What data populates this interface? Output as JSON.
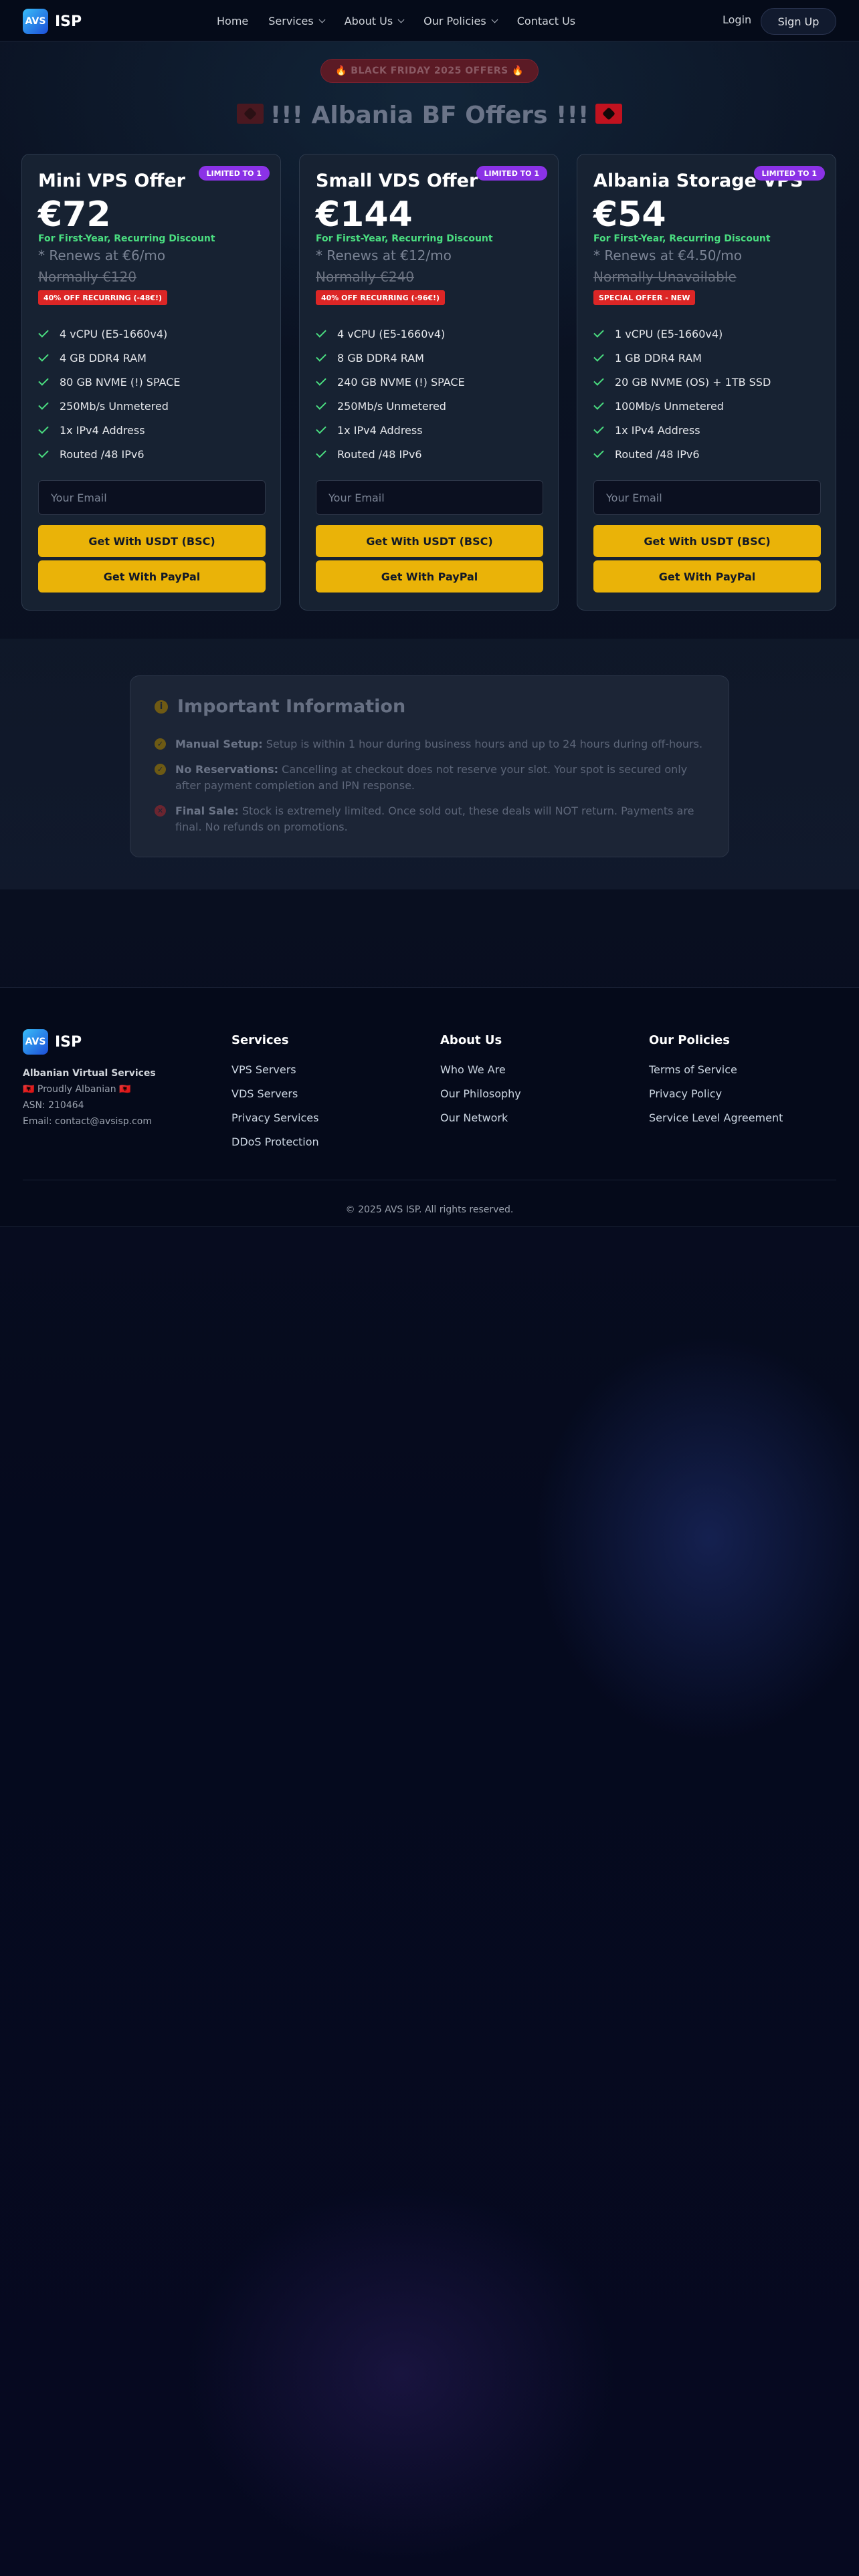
{
  "nav": {
    "logo_text": "AVS",
    "brand": "ISP",
    "links": [
      {
        "label": "Home",
        "has_menu": false
      },
      {
        "label": "Services",
        "has_menu": true
      },
      {
        "label": "About Us",
        "has_menu": true
      },
      {
        "label": "Our Policies",
        "has_menu": true
      },
      {
        "label": "Contact Us",
        "has_menu": false
      }
    ],
    "login": "Login",
    "signup": "Sign Up"
  },
  "hero": {
    "badge": "🔥 BLACK FRIDAY 2025 OFFERS 🔥",
    "title": "!!! Albania BF Offers !!!"
  },
  "offers": [
    {
      "name": "Mini VPS Offer",
      "badge": "LIMITED TO 1",
      "price": "€72",
      "discount_note": "For First-Year, Recurring Discount",
      "renews": "* Renews at €6/mo",
      "normally": "Normally €120",
      "promo": "40% OFF RECURRING (-48€!)",
      "features": [
        "4 vCPU (E5-1660v4)",
        "4 GB DDR4 RAM",
        "80 GB NVME (!) SPACE",
        "250Mb/s Unmetered",
        "1x IPv4 Address",
        "Routed /48 IPv6"
      ],
      "email_placeholder": "Your Email",
      "btn_usdt": "Get With USDT (BSC)",
      "btn_paypal": "Get With PayPal"
    },
    {
      "name": "Small VDS Offer",
      "badge": "LIMITED TO 1",
      "price": "€144",
      "discount_note": "For First-Year, Recurring Discount",
      "renews": "* Renews at €12/mo",
      "normally": "Normally €240",
      "promo": "40% OFF RECURRING (-96€!)",
      "features": [
        "4 vCPU (E5-1660v4)",
        "8 GB DDR4 RAM",
        "240 GB NVME (!) SPACE",
        "250Mb/s Unmetered",
        "1x IPv4 Address",
        "Routed /48 IPv6"
      ],
      "email_placeholder": "Your Email",
      "btn_usdt": "Get With USDT (BSC)",
      "btn_paypal": "Get With PayPal"
    },
    {
      "name": "Albania Storage VPS",
      "badge": "LIMITED TO 1",
      "price": "€54",
      "discount_note": "For First-Year, Recurring Discount",
      "renews": "* Renews at €4.50/mo",
      "normally": "Normally Unavailable",
      "promo": "SPECIAL OFFER - NEW",
      "features": [
        "1 vCPU (E5-1660v4)",
        "1 GB DDR4 RAM",
        "20 GB NVME (OS) + 1TB SSD",
        "100Mb/s Unmetered",
        "1x IPv4 Address",
        "Routed /48 IPv6"
      ],
      "email_placeholder": "Your Email",
      "btn_usdt": "Get With USDT (BSC)",
      "btn_paypal": "Get With PayPal"
    }
  ],
  "info": {
    "title": "Important Information",
    "items": [
      {
        "label": "Manual Setup:",
        "text": "Setup is within 1 hour during business hours and up to 24 hours during off-hours.",
        "status": "ok"
      },
      {
        "label": "No Reservations:",
        "text": "Cancelling at checkout does not reserve your slot. Your spot is secured only after payment completion and IPN response.",
        "status": "ok"
      },
      {
        "label": "Final Sale:",
        "text": "Stock is extremely limited. Once sold out, these deals will NOT return. Payments are final. No refunds on promotions.",
        "status": "no"
      }
    ]
  },
  "footer": {
    "logo_text": "AVS",
    "brand": "ISP",
    "company": "Albanian Virtual Services",
    "tagline": "🇦🇱 Proudly Albanian 🇦🇱",
    "asn": "ASN: 210464",
    "email": "Email: contact@avsisp.com",
    "columns": [
      {
        "title": "Services",
        "links": [
          "VPS Servers",
          "VDS Servers",
          "Privacy Services",
          "DDoS Protection"
        ]
      },
      {
        "title": "About Us",
        "links": [
          "Who We Are",
          "Our Philosophy",
          "Our Network"
        ]
      },
      {
        "title": "Our Policies",
        "links": [
          "Terms of Service",
          "Privacy Policy",
          "Service Level Agreement"
        ]
      }
    ],
    "copyright": "© 2025 AVS ISP. All rights reserved."
  },
  "colors": {
    "accent_yellow": "#eab308",
    "badge_purple": "#8b32e6",
    "promo_red": "#dc2626",
    "check_green": "#4ade80"
  }
}
